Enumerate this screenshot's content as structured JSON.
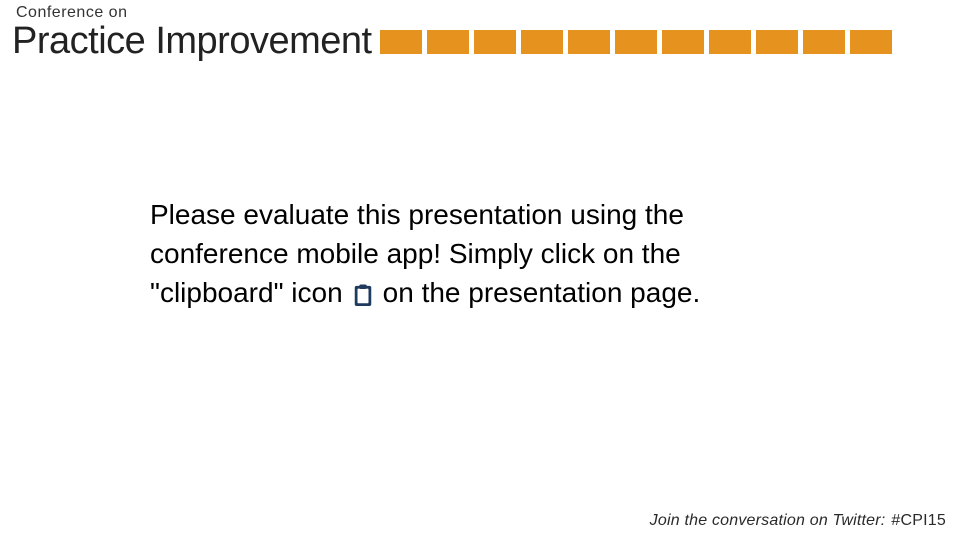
{
  "header": {
    "pretitle": "Conference on",
    "title": "Practice Improvement",
    "square_count": 11,
    "accent_color": "#e6921e"
  },
  "body": {
    "line1": "Please evaluate this presentation using the",
    "line2": "conference mobile app! Simply click on the",
    "line3_before": "\"clipboard\" icon",
    "line3_after": "on the presentation page.",
    "icon_name": "clipboard-icon"
  },
  "footer": {
    "lead": "Join the conversation on Twitter:",
    "hashtag": "#CPI15"
  }
}
